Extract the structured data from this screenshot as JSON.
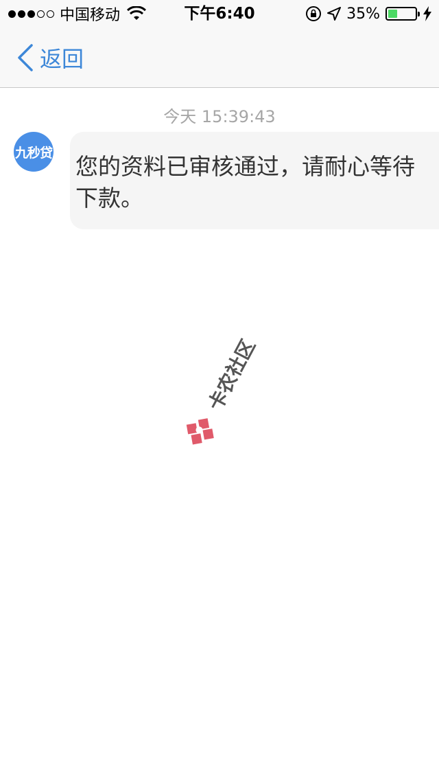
{
  "status_bar": {
    "carrier": "中国移动",
    "time": "下午6:40",
    "battery_percent": "35%",
    "battery_level": 0.35,
    "signal_bars_filled": 3,
    "signal_bars_total": 5,
    "battery_color": "#4cd964"
  },
  "nav": {
    "back_label": "返回",
    "accent_color": "#3d87d8"
  },
  "chat": {
    "timestamp": "今天 15:39:43",
    "avatar_text": "九秒贷",
    "message": "您的资料已审核通过，请耐心等待下款。"
  },
  "watermark": {
    "text": "卡农社区"
  }
}
